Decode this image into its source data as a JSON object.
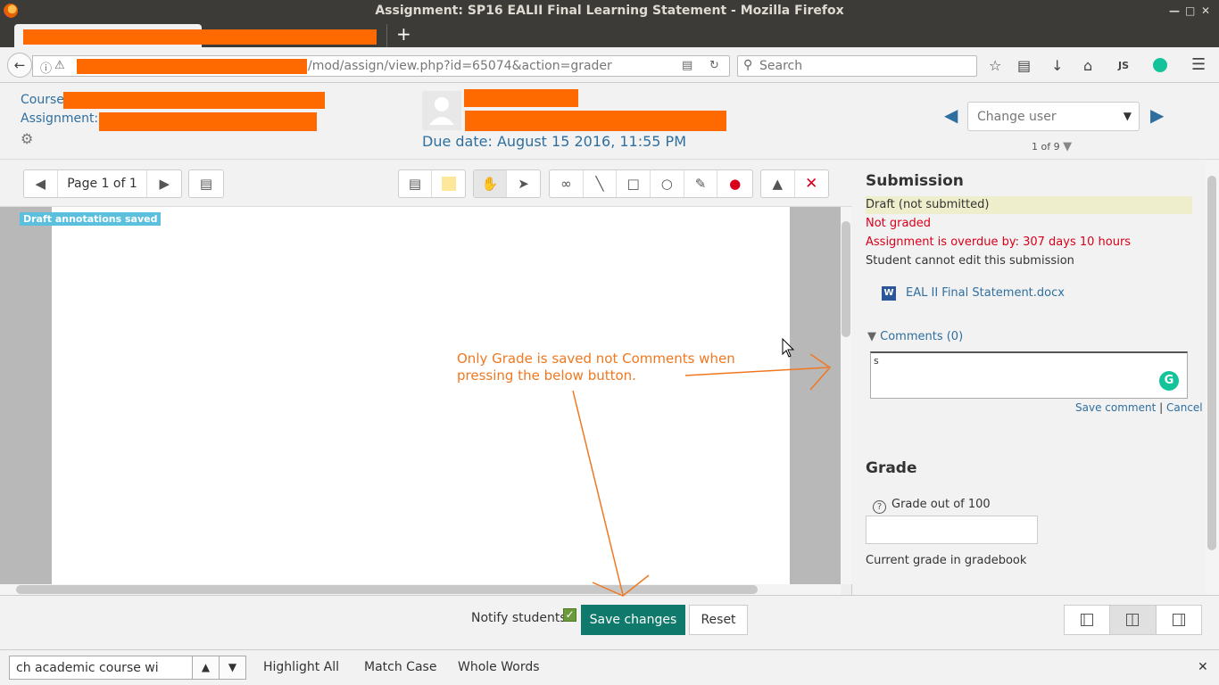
{
  "window": {
    "title": "Assignment: SP16 EALII Final Learning Statement - Mozilla Firefox"
  },
  "browser": {
    "new_tab_label": "+",
    "url_visible": "/mod/assign/view.php?id=65074&action=grader",
    "search_placeholder": "Search",
    "toolbar_icons": [
      "bookmark-star-icon",
      "reading-list-icon",
      "download-icon",
      "home-icon",
      "js-icon",
      "grammarly-icon",
      "menu-icon"
    ],
    "js_label": "JS"
  },
  "header": {
    "course_label": "Course:",
    "assignment_label": "Assignment: S",
    "due_date": "Due date: August 15 2016, 11:55 PM",
    "change_user_placeholder": "Change user",
    "user_count": "1 of 9"
  },
  "pdf": {
    "page_label": "Page 1 of 1",
    "draft_badge": "Draft annotations saved"
  },
  "submission": {
    "title": "Submission",
    "status": "Draft (not submitted)",
    "grading_status": "Not graded",
    "overdue": "Assignment is overdue by: 307 days 10 hours",
    "edit_status": "Student cannot edit this submission",
    "file_name": "EAL II Final Statement.docx",
    "file_icon_letter": "W",
    "comments_label": "Comments (0)",
    "comment_text": "s",
    "save_comment": "Save comment",
    "separator": "|",
    "cancel": "Cancel"
  },
  "grade": {
    "title": "Grade",
    "grade_label": "Grade out of 100",
    "current_grade_label": "Current grade in gradebook"
  },
  "bottom": {
    "notify_label": "Notify students",
    "save_label": "Save changes",
    "reset_label": "Reset"
  },
  "findbar": {
    "query": "ch academic course wi",
    "highlight_all": "Highlight All",
    "match_case": "Match Case",
    "whole_words": "Whole Words"
  },
  "annotation": {
    "text": "Only Grade is saved not Comments when pressing the below button.",
    "color": "#f07820"
  },
  "colors": {
    "accent": "#2f6f9f",
    "save_button": "#0f7a6b",
    "error": "#d9001b",
    "redaction": "#ff6a00"
  }
}
